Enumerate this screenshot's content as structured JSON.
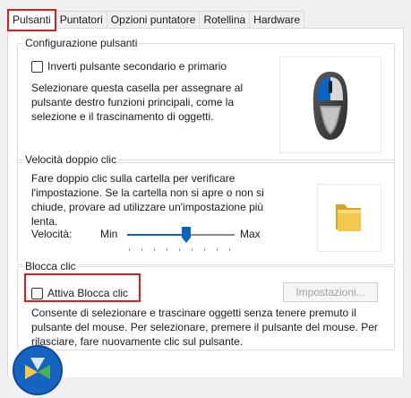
{
  "tabs": [
    {
      "label": "Pulsanti",
      "active": true
    },
    {
      "label": "Puntatori",
      "active": false
    },
    {
      "label": "Opzioni puntatore",
      "active": false
    },
    {
      "label": "Rotellina",
      "active": false
    },
    {
      "label": "Hardware",
      "active": false
    }
  ],
  "button_config": {
    "title": "Configurazione pulsanti",
    "checkbox_label": "Inverti pulsante secondario e primario",
    "checked": false,
    "description": "Selezionare questa casella per assegnare al pulsante destro funzioni principali, come la selezione e il trascinamento di oggetti.",
    "image_icon": "mouse-icon"
  },
  "double_click": {
    "title": "Velocità doppio clic",
    "description": "Fare doppio clic sulla cartella per verificare l'impostazione. Se la cartella non si apre o non si chiude, provare ad utilizzare un'impostazione più lenta.",
    "speed_label": "Velocità:",
    "min_label": "Min",
    "max_label": "Max",
    "slider_value_fraction": 0.55,
    "image_icon": "folder-icon"
  },
  "click_lock": {
    "title": "Blocca clic",
    "checkbox_label": "Attiva Blocca clic",
    "checked": false,
    "settings_button": "Impostazioni...",
    "settings_enabled": false,
    "description": "Consente di selezionare e trascinare oggetti senza tenere premuto il pulsante del mouse. Per selezionare, premere il pulsante del mouse. Per rilasciare, fare nuovamente clic sul pulsante."
  },
  "colors": {
    "highlight": "#e01b1b",
    "accent_blue": "#0a64c8",
    "folder_yellow": "#f2c94c"
  }
}
